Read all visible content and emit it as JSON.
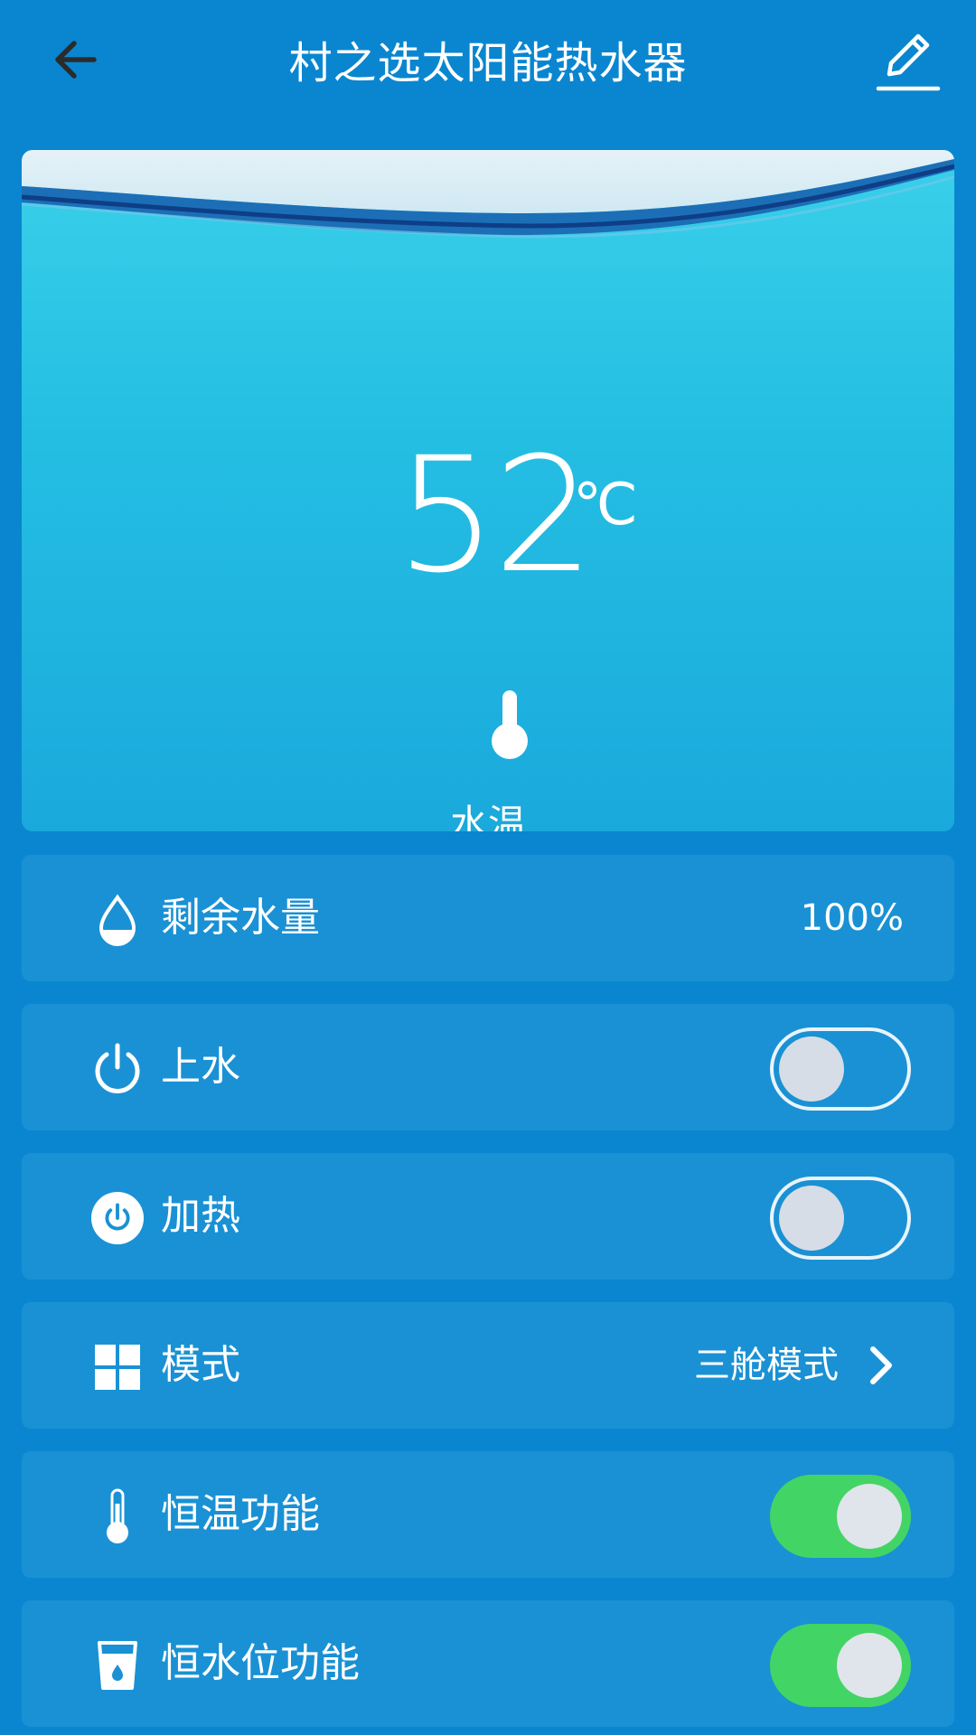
{
  "header": {
    "title": "村之选太阳能热水器",
    "back_icon": "arrow-left-icon",
    "edit_icon": "pencil-icon"
  },
  "hero": {
    "temperature": "52",
    "unit": "℃",
    "thermo_icon": "thermometer-icon",
    "label": "水温"
  },
  "rows": {
    "water_remaining": {
      "icon": "water-drop-icon",
      "label": "剩余水量",
      "value": "100%"
    },
    "fill_water": {
      "icon": "power-icon",
      "label": "上水",
      "toggle_on": false
    },
    "heating": {
      "icon": "power-circle-icon",
      "label": "加热",
      "toggle_on": false
    },
    "mode": {
      "icon": "grid-icon",
      "label": "模式",
      "value": "三舱模式",
      "chevron_icon": "chevron-right-icon"
    },
    "constant_temp": {
      "icon": "thermometer-icon",
      "label": "恒温功能",
      "toggle_on": true
    },
    "constant_level": {
      "icon": "water-cup-icon",
      "label": "恒水位功能",
      "toggle_on": true
    }
  },
  "colors": {
    "background": "#0a86d0",
    "row_bg": "#1a91d4",
    "toggle_on": "#43d466",
    "toggle_off_knob": "#d6dde6"
  }
}
